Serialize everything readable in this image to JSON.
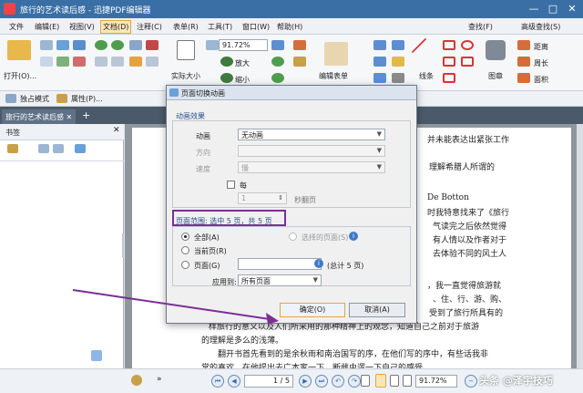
{
  "window": {
    "title": "旅行的艺术读后感 - 迅捷PDF编辑器"
  },
  "menu": [
    "文件",
    "编辑(E)",
    "视图(V)",
    "文档(D)",
    "注释(C)",
    "表单(R)",
    "工具(T)",
    "窗口(W)",
    "帮助(H)"
  ],
  "menu_right": {
    "find": "查找(F)",
    "adv_find": "高级查找(S)"
  },
  "ribbon": {
    "open": "打开(O)...",
    "actual_size": "实际大小",
    "zoom_value": "91.72%",
    "zoom_in": "放大",
    "zoom_out": "缩小",
    "edit_form": "编辑表单",
    "line": "线条",
    "stamp": "图章",
    "distance": "距离",
    "perimeter": "周长",
    "area": "面积"
  },
  "toolbar2": {
    "exclusive": "独占模式",
    "properties": "属性(P)..."
  },
  "tab": {
    "label": "旅行的艺术读后感"
  },
  "sidebar": {
    "title": "书签"
  },
  "doc_lines": [
    "并未能表达出紧张工作",
    "理解希腊人所谓的",
    "De Botton",
    "时我特意找来了《旅行",
    "气读完之后依然觉得",
    "有人情以及作者对于",
    "去体验不同的风土人",
    "，我一直觉得旅游就",
    "、住、行、游、购、",
    "受到了旅行所具有的",
    "样旅行的意义以及人们所采用的那种精神上的观念，知道自己之前对于旅游",
    "的理解是多么的浅薄。",
    "翻开书首先看到的是余秋雨和南治国写的序，在他们写的序中，有些话我非",
    "常的喜欢，在他提出去广本家一下，断雌虫逻一下自己的感受"
  ],
  "dialog": {
    "title": "页面切换动画",
    "section": "动画效果",
    "animation_label": "动画",
    "animation_value": "无动画",
    "direction_label": "方向",
    "speed_label": "速度",
    "speed_value": "慢",
    "every_label": "每",
    "every_value": "1",
    "seconds_label": "秒翻页",
    "range_text": "页面范围: 选中 5 页，共 5 页",
    "all_label": "全部(A)",
    "selected_label": "选择的页面(S)",
    "current_label": "当前页(R)",
    "pages_label": "页面(G)",
    "total_text": "(总计 5 页)",
    "apply_label": "应用到:",
    "apply_value": "所有页面",
    "ok": "确定(O)",
    "cancel": "取消(A)"
  },
  "status": {
    "page_input": "1",
    "page_total": "/ 5",
    "zoom": "91.72%",
    "watermark": "头条 @泽宇技巧"
  },
  "colors": {
    "titlebar": "#3a6fa5",
    "range_border": "#7b2f96",
    "arrow": "#7b2f96",
    "ok_border": "#d9a94a"
  }
}
